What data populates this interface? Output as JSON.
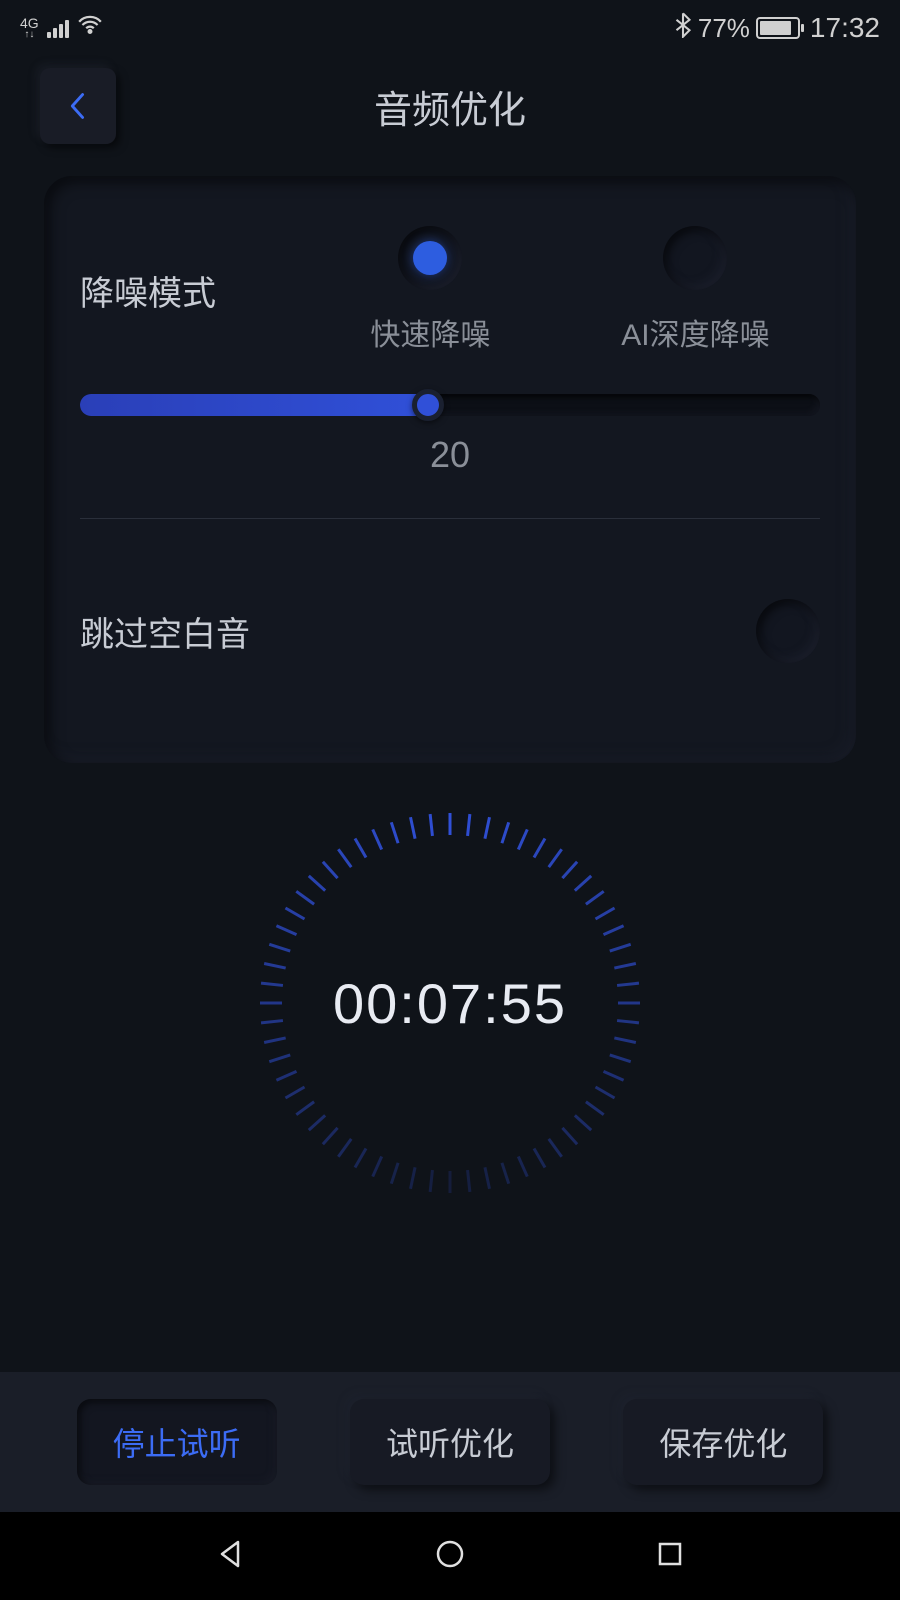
{
  "statusbar": {
    "network": "4G",
    "battery_percent": "77%",
    "time": "17:32"
  },
  "header": {
    "title": "音频优化"
  },
  "noise": {
    "label": "降噪模式",
    "options": [
      {
        "label": "快速降噪",
        "selected": true
      },
      {
        "label": "AI深度降噪",
        "selected": false
      }
    ],
    "slider_value": "20",
    "slider_percent": 47
  },
  "skip_silence": {
    "label": "跳过空白音",
    "enabled": false
  },
  "timer": {
    "elapsed": "00:07:55"
  },
  "actions": {
    "stop": "停止试听",
    "preview": "试听优化",
    "save": "保存优化"
  }
}
